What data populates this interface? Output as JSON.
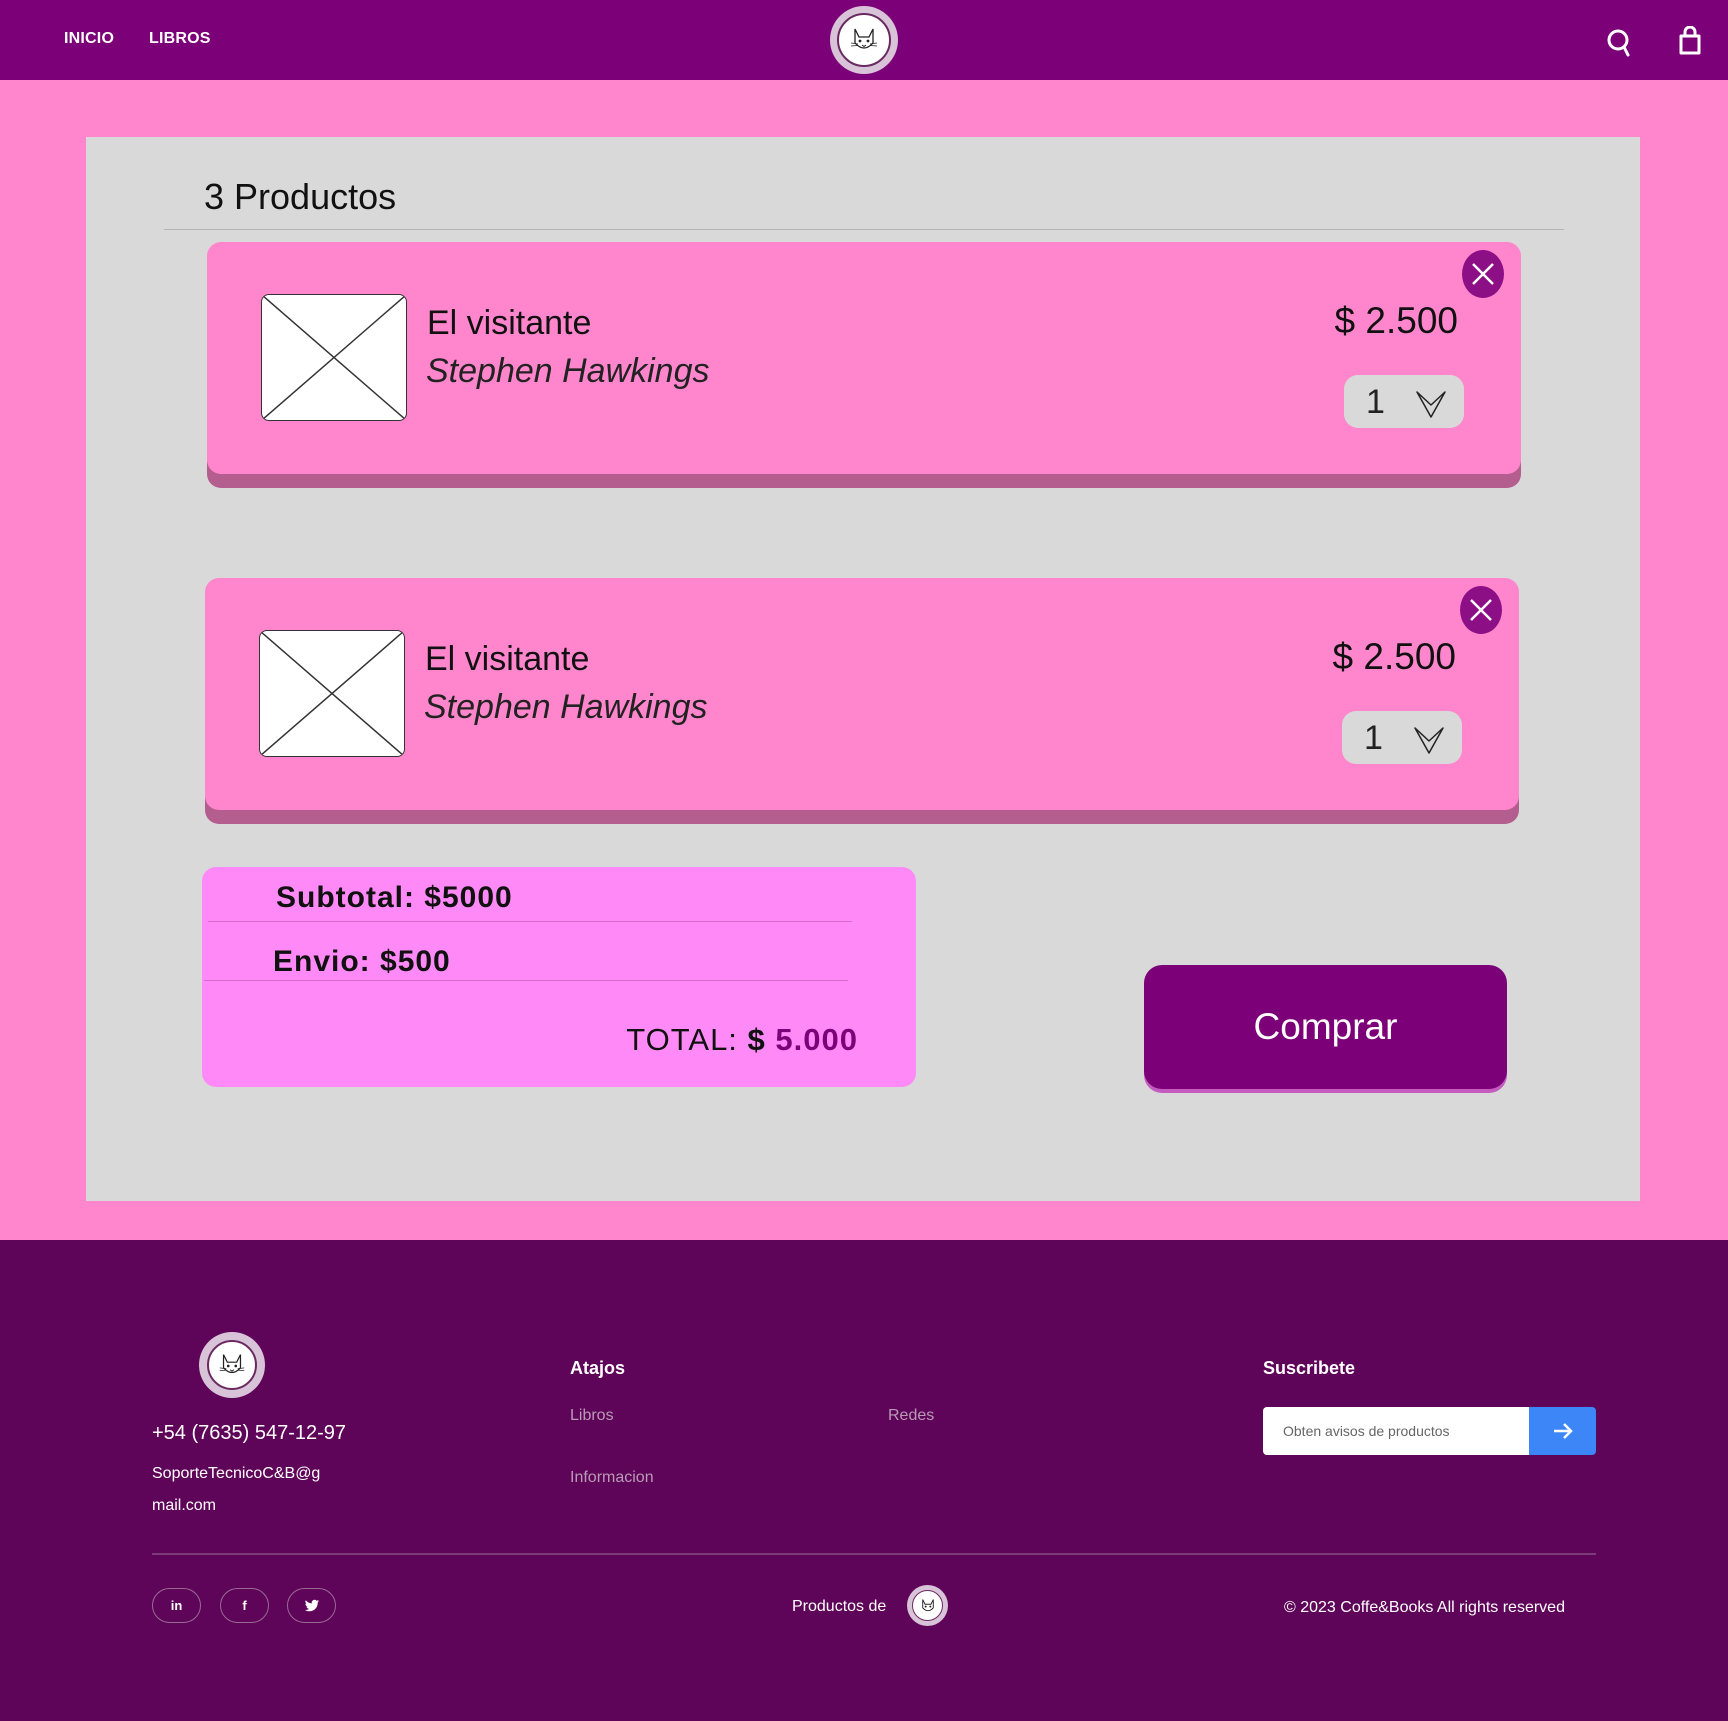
{
  "header": {
    "nav": [
      {
        "label": "INICIO"
      },
      {
        "label": "LIBROS"
      }
    ],
    "icons": [
      "search-icon",
      "shopping-bag-icon"
    ]
  },
  "cart": {
    "count_title": "3 Productos",
    "items": [
      {
        "title": "El visitante",
        "author": "Stephen Hawkings",
        "price": "$ 2.500",
        "quantity": "1"
      },
      {
        "title": "El visitante",
        "author": "Stephen Hawkings",
        "price": "$ 2.500",
        "quantity": "1"
      }
    ],
    "summary": {
      "subtotal": "Subtotal: $5000",
      "shipping": "Envio: $500",
      "total_label": "TOTAL:",
      "total_currency": "$",
      "total_amount": "5.000"
    },
    "buy_label": "Comprar"
  },
  "footer": {
    "phone": "+54 (7635) 547-12-97",
    "email_line1": "SoporteTecnicoC&B@g",
    "email_line2": "mail.com",
    "shortcuts_heading": "Atajos",
    "links": [
      {
        "label": "Libros"
      },
      {
        "label": "Redes"
      },
      {
        "label": "Informacion"
      }
    ],
    "subscribe_heading": "Suscribete",
    "subscribe_placeholder": "Obten avisos de productos",
    "social": [
      {
        "label": "in"
      },
      {
        "label": "f"
      }
    ],
    "products_by": "Productos de",
    "copyright": "© 2023 Coffe&Books All rights reserved"
  },
  "colors": {
    "header_bg": "#7c0077",
    "page_bg": "#ff86cd",
    "panel_bg": "#d9d9d9",
    "item_bg": "#ff86cd",
    "summary_bg": "#ff8af7",
    "footer_bg": "#5f0559",
    "subscribe_button": "#3d86f7"
  }
}
